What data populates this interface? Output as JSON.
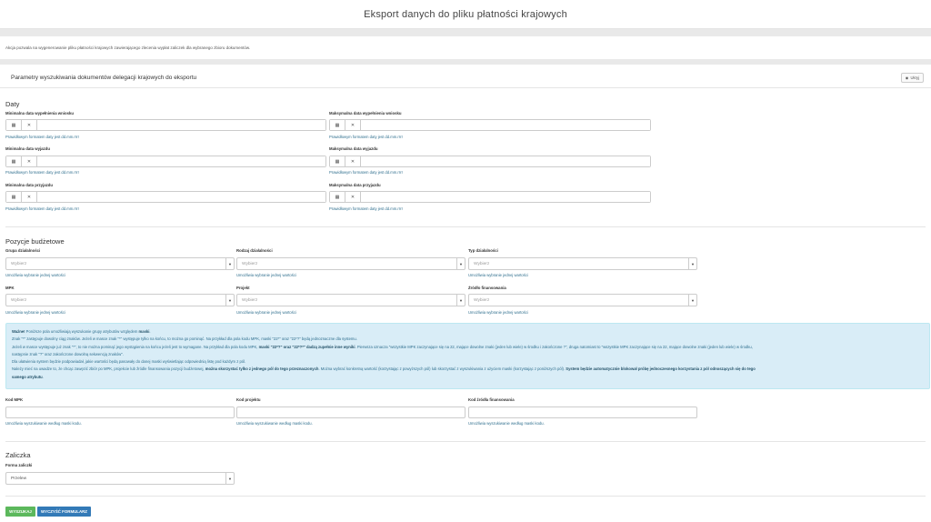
{
  "page_title": "Eksport danych do pliku płatności krajowych",
  "info": "Akcja pozwala na wygenerowanie pliku płatności krajowych zawierającego zlecenia wypłat zaliczek dla wybranego zbioru dokumentów.",
  "params": {
    "title": "Parametry wyszukiwania dokumentów delegacji krajowych do eksportu",
    "hide_label": "Ukryj"
  },
  "dates": {
    "heading": "Daty",
    "hint": "Prawidłowym formatem daty jest dd.mm.rrrr",
    "min_fill": "Minimalna data wypełnienia wniosku",
    "max_fill": "Maksymalna data wypełnienia wniosku",
    "min_dep": "Minimalna data wyjazdu",
    "max_dep": "Maksymalna data wyjazdu",
    "min_arr": "Minimalna data przyjazdu",
    "max_arr": "Maksymalna data przyjazdu"
  },
  "budget": {
    "heading": "Pozycje budżetowe",
    "placeholder": "Wybierz",
    "single_hint": "Umożliwia wybranie jednej wartości",
    "grupa": "Grupa działalności",
    "rodzaj": "Rodzaj działalności",
    "typ": "Typ działalności",
    "mpk": "MPK",
    "projekt": "Projekt",
    "zrodlo": "Źródło finansowania"
  },
  "alert": {
    "l1_bold": "Ważne!",
    "l1_a": " Poniższe pola umożliwiają wyszukanie grupy atrybutów względem ",
    "l1_bold2": "maski",
    "l1_b": ".",
    "l2": "Znak \"*\" zastępuje dowolny ciąg znaków. Jeżeli w masce znak \"*\" występuje tylko na końcu, to można go pominąć. Na przykład dla pola kodu MPK, maski \"22*\" oraz \"22*?\" będą jednoznaczne dla systemu.",
    "l3_a": "Jeżeli w masce występuje już znak \"*\", to nie można pominąć jego wystąpienia na końcu jeżeli jest to wymagane. Na przykład dla pola kodu MPK, ",
    "l3_bold": "maski \"22*?\" oraz \"22*?*\" dadzą zupełnie inne wyniki",
    "l3_b": ". Pierwsza oznacza \"wszystkie MPK zaczynające się na 22, mające dowolne znaki (jeden lub wiele) w środku i zakończone ?\", druga natomiast to \"wszystkie MPK zaczynające się na 22, mające dowolne znaki (jeden lub wiele) w środku,",
    "l4": "następnie znak \"?\" oraz zakończone dowolną sekwencją znaków\".",
    "l5": "Dla ułatwienia system będzie podpowiadał, jakie wartości będą pasowały do danej maski wyświetlając odpowiednią listę pod każdym z pól.",
    "l6_a": "Należy mieć na uwadze to, że chcąc zawęzić zbiór po MPK, projekcie lub źródle finansowania pozycji budżetowej, ",
    "l6_bold": "można skorzystać tylko z jednego pól do tego przeznaczonych",
    "l6_b": ". Można wybrać konkretną wartość (korzystając z powyższych pól) lub skorzystać z wyszukiwania z użyciem maski (korzystając z poniższych pól). ",
    "l6_bold2": "System będzie automatycznie blokował próbę jednoczesnego korzystania z pól odnoszących się do tego",
    "l7_bold": "samego atrybutu",
    "l7_b": "."
  },
  "codes": {
    "mpk": "Kod MPK",
    "projekt": "Kod projektu",
    "zrodlo": "Kod źródła finansowania",
    "hint": "Umożliwia wyszukiwanie według maski kodu."
  },
  "zaliczka": {
    "heading": "Zaliczka",
    "forma_label": "Forma zaliczki",
    "forma_value": "Przelew"
  },
  "buttons": {
    "search": "WYSZUKAJ",
    "clear": "WYCZYŚĆ FORMULARZ"
  },
  "colors": {
    "btn_green": "#5cb85c",
    "btn_blue": "#337ab7"
  }
}
